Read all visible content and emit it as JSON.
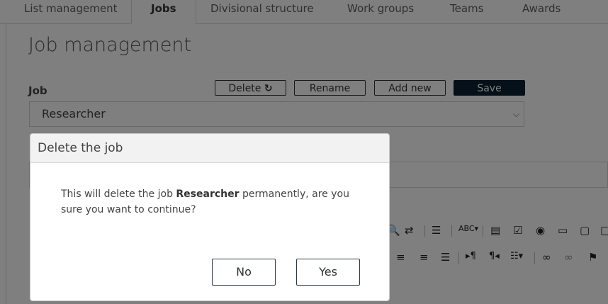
{
  "tabs": [
    {
      "label": "List management"
    },
    {
      "label": "Jobs"
    },
    {
      "label": "Divisional structure"
    },
    {
      "label": "Work groups"
    },
    {
      "label": "Teams"
    },
    {
      "label": "Awards"
    }
  ],
  "page": {
    "title": "Job management",
    "job_label": "Job",
    "selected_job": "Researcher"
  },
  "toolbar": {
    "delete_label": "Delete",
    "rename_label": "Rename",
    "add_label": "Add new",
    "save_label": "Save"
  },
  "dialog": {
    "title": "Delete the job",
    "message_before": "This will delete the job ",
    "message_job": "Researcher",
    "message_after": " permanently, are you sure you want to continue?",
    "no_label": "No",
    "yes_label": "Yes"
  },
  "colors": {
    "save_bg": "#0b2130",
    "overlay": "rgba(0,0,0,0.5)"
  }
}
